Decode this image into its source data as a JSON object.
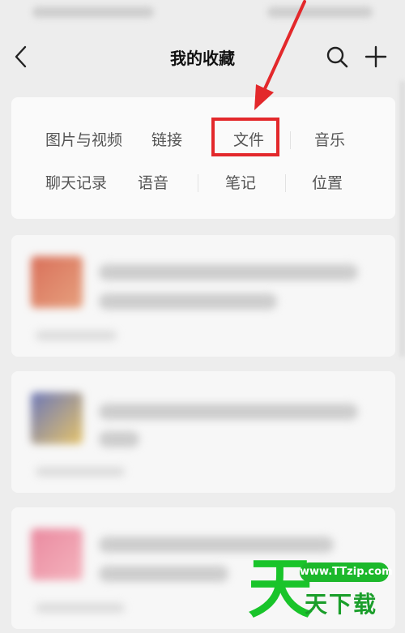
{
  "header": {
    "title": "我的收藏"
  },
  "categories": [
    {
      "label": "图片与视频"
    },
    {
      "label": "链接"
    },
    {
      "label": "文件"
    },
    {
      "label": "音乐"
    },
    {
      "label": "聊天记录"
    },
    {
      "label": "语音"
    },
    {
      "label": "笔记"
    },
    {
      "label": "位置"
    }
  ],
  "highlight": {
    "target": "文件",
    "color": "#e3282b"
  },
  "watermark": {
    "logo_char": "天",
    "url": "www.TTzip.com",
    "text": "天下载",
    "color": "#19c42a"
  },
  "icons": {
    "back": "chevron-left-icon",
    "search": "search-icon",
    "add": "plus-icon"
  }
}
